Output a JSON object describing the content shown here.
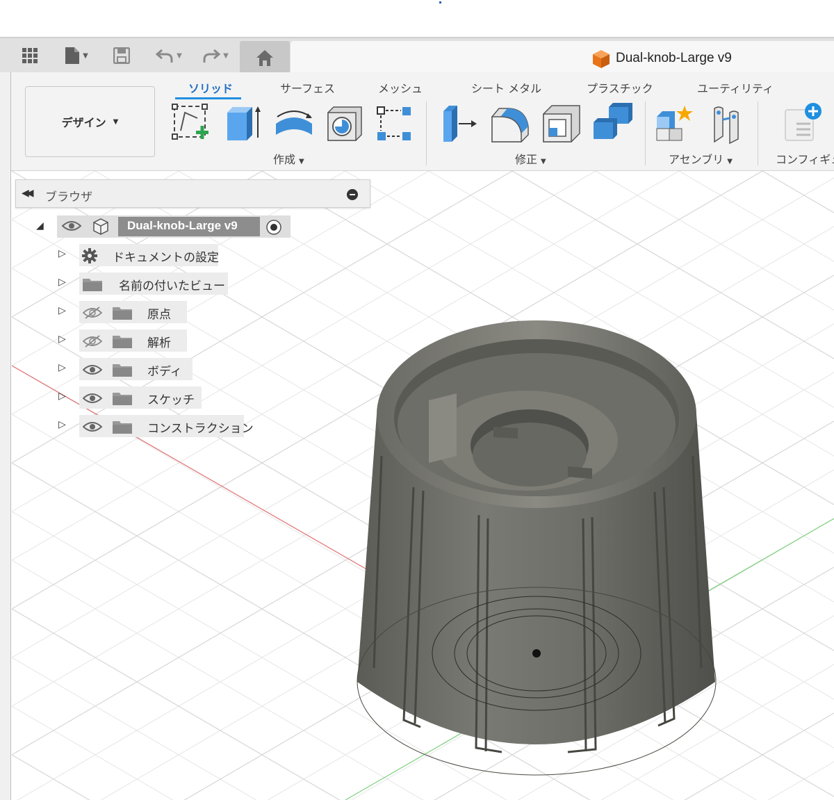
{
  "window": {
    "document_title": "Dual-knob-Large v9"
  },
  "quick_access": {
    "icons": [
      "grid-icon",
      "file-icon",
      "save-icon",
      "undo-icon",
      "redo-icon",
      "home-icon"
    ]
  },
  "ribbon": {
    "workspace": "デザイン",
    "tabs": [
      {
        "label": "ソリッド",
        "active": true
      },
      {
        "label": "サーフェス"
      },
      {
        "label": "メッシュ"
      },
      {
        "label": "シート メタル"
      },
      {
        "label": "プラスチック"
      },
      {
        "label": "ユーティリティ"
      }
    ],
    "groups": {
      "create": "作成",
      "modify": "修正",
      "assemble": "アセンブリ",
      "configure": "コンフィギュレ"
    }
  },
  "browser": {
    "title": "ブラウザ",
    "root": "Dual-knob-Large v9",
    "items": [
      {
        "label": "ドキュメントの設定",
        "icon": "gear-icon"
      },
      {
        "label": "名前の付いたビュー",
        "icon": "folder-icon"
      },
      {
        "label": "原点",
        "icon": "folder-icon",
        "visible": false
      },
      {
        "label": "解析",
        "icon": "folder-icon",
        "visible": false
      },
      {
        "label": "ボディ",
        "icon": "folder-icon",
        "visible": true
      },
      {
        "label": "スケッチ",
        "icon": "folder-icon",
        "visible": true
      },
      {
        "label": "コンストラクション",
        "icon": "folder-icon",
        "visible": true
      }
    ]
  },
  "colors": {
    "accent": "#1f8fe0",
    "model": "#6e6e66",
    "axis_x": "#e06060",
    "axis_y": "#60c060"
  }
}
